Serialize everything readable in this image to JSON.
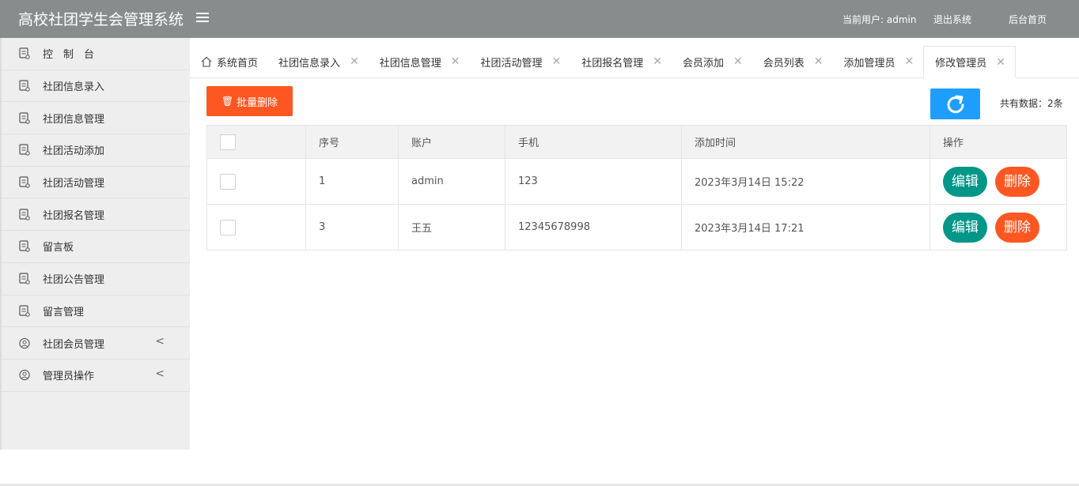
{
  "header": {
    "app_title": "高校社团学生会管理系统",
    "current_user": "当前用户: admin",
    "logout": "退出系统",
    "home": "后台首页"
  },
  "sidebar": {
    "items": [
      {
        "label": "控　制　台",
        "icon": "document-icon"
      },
      {
        "label": "社团信息录入",
        "icon": "document-icon"
      },
      {
        "label": "社团信息管理",
        "icon": "document-icon"
      },
      {
        "label": "社团活动添加",
        "icon": "document-icon"
      },
      {
        "label": "社团活动管理",
        "icon": "document-icon"
      },
      {
        "label": "社团报名管理",
        "icon": "document-icon"
      },
      {
        "label": "留言板",
        "icon": "document-icon"
      },
      {
        "label": "社团公告管理",
        "icon": "document-icon"
      },
      {
        "label": "留言管理",
        "icon": "document-icon"
      },
      {
        "label": "社团会员管理",
        "icon": "user-circle-icon",
        "arrow": "<"
      },
      {
        "label": "管理员操作",
        "icon": "user-circle-icon",
        "arrow": "<"
      }
    ]
  },
  "tabs": [
    {
      "label": "系统首页",
      "closable": false
    },
    {
      "label": "社团信息录入",
      "closable": true
    },
    {
      "label": "社团信息管理",
      "closable": true
    },
    {
      "label": "社团活动管理",
      "closable": true
    },
    {
      "label": "社团报名管理",
      "closable": true
    },
    {
      "label": "会员添加",
      "closable": true
    },
    {
      "label": "会员列表",
      "closable": true
    },
    {
      "label": "添加管理员",
      "closable": true
    },
    {
      "label": "修改管理员",
      "closable": true,
      "active": true
    }
  ],
  "tab_close": "✕",
  "toolbar": {
    "batch_delete": "批量删除",
    "total": "共有数据：2条"
  },
  "table": {
    "headers": [
      "",
      "序号",
      "账户",
      "手机",
      "添加时间",
      "操作"
    ],
    "rows": [
      {
        "id": "1",
        "account": "admin",
        "phone": "123",
        "time": "2023年3月14日 15:22"
      },
      {
        "id": "3",
        "account": "王五",
        "phone": "12345678998",
        "time": "2023年3月14日 17:21"
      }
    ],
    "edit_label": "编辑",
    "delete_label": "删除"
  },
  "colors": {
    "header_bg": "#888c8d",
    "danger": "#ff5722",
    "primary": "#1e9fff",
    "success": "#009688"
  }
}
